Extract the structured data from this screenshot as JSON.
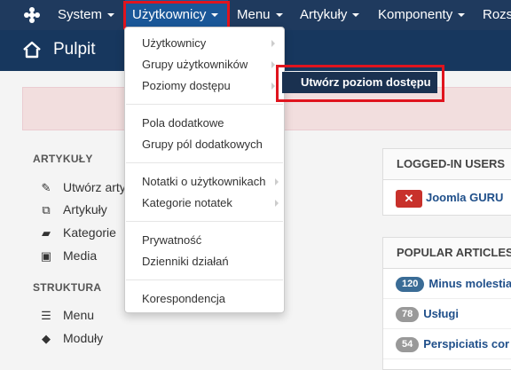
{
  "topnav": {
    "items": [
      "System",
      "Użytkownicy",
      "Menu",
      "Artykuły",
      "Komponenty",
      "Rozs"
    ]
  },
  "header": {
    "title": "Pulpit"
  },
  "sidebar": {
    "articles_title": "ARTYKUŁY",
    "articles_links": [
      "Utwórz arty",
      "Artykuły",
      "Kategorie",
      "Media"
    ],
    "structure_title": "STRUKTURA",
    "structure_links": [
      "Menu",
      "Moduły"
    ]
  },
  "dropdown": {
    "items": [
      "Użytkownicy",
      "Grupy użytkowników",
      "Poziomy dostępu",
      "Pola dodatkowe",
      "Grupy pól dodatkowych",
      "Notatki o użytkownikach",
      "Kategorie notatek",
      "Prywatność",
      "Dzienniki działań",
      "Korespondencja"
    ]
  },
  "submenu": {
    "label": "Utwórz poziom dostępu"
  },
  "logged_in": {
    "title": "LOGGED-IN USERS",
    "user": "Joomla GURU"
  },
  "popular": {
    "title": "POPULAR ARTICLES",
    "rows": [
      {
        "count": "120",
        "title": "Minus molestia"
      },
      {
        "count": "78",
        "title": "Usługi"
      },
      {
        "count": "54",
        "title": "Perspiciatis cor"
      }
    ]
  },
  "colors": {
    "topbar": "#1f3a5e",
    "subheader": "#17375e",
    "highlight": "#e0141e",
    "submenu": "#1a3150"
  }
}
